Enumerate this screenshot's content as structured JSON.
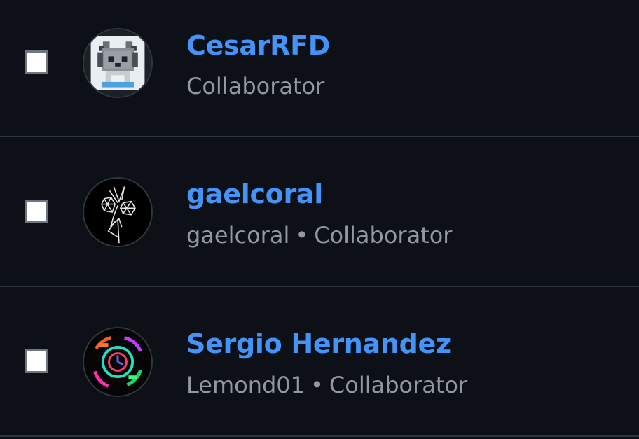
{
  "colors": {
    "background": "#0d1117",
    "divider": "#30363d",
    "link": "#4493f8",
    "muted": "#9198a1",
    "checkbox": "#ffffff"
  },
  "members": [
    {
      "name": "CesarRFD",
      "username": "",
      "role": "Collaborator",
      "avatar_icon": "pixel-cat-avatar",
      "checked": false
    },
    {
      "name": "gaelcoral",
      "username": "gaelcoral",
      "role": "Collaborator",
      "avatar_icon": "line-art-avatar",
      "checked": false
    },
    {
      "name": "Sergio Hernandez",
      "username": "Lemond01",
      "role": "Collaborator",
      "avatar_icon": "neon-clock-avatar",
      "checked": false
    }
  ],
  "separator": "•"
}
